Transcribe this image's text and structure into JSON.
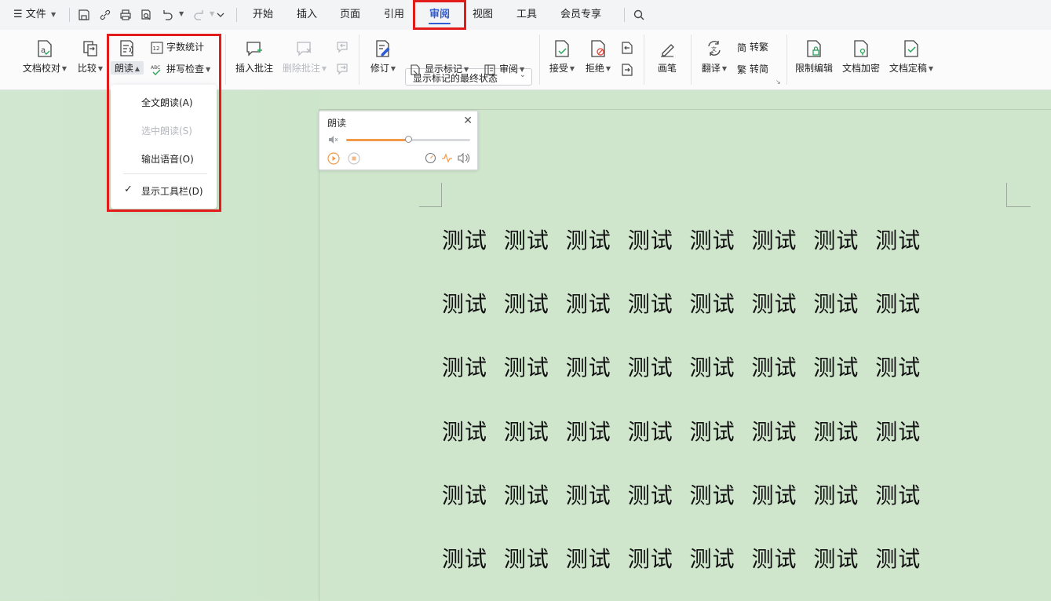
{
  "titlebar": {
    "file_menu": "文件",
    "tabs": [
      "开始",
      "插入",
      "页面",
      "引用",
      "审阅",
      "视图",
      "工具",
      "会员专享"
    ],
    "active_tab": "审阅"
  },
  "ribbon": {
    "proofread": "文档校对",
    "compare": "比较",
    "read_aloud": "朗读",
    "word_count": "字数统计",
    "spell_check": "拼写检查",
    "insert_comment": "插入批注",
    "delete_comment": "删除批注",
    "revise": "修订",
    "markup_state": "显示标记的最终状态",
    "show_markup": "显示标记",
    "review": "审阅",
    "accept": "接受",
    "reject": "拒绝",
    "pen": "画笔",
    "translate": "翻译",
    "to_traditional": "转繁",
    "to_simplified": "转简",
    "restrict_edit": "限制编辑",
    "encrypt": "文档加密",
    "finalize": "文档定稿",
    "trad_icon_text": "简",
    "simp_icon_text": "繁",
    "count_icon_text": "12",
    "abc_icon_text": "ABC"
  },
  "read_menu": {
    "items": [
      "全文朗读(A)",
      "选中朗读(S)",
      "输出语音(O)",
      "显示工具栏(D)"
    ],
    "check_mark": "✓"
  },
  "reader_panel": {
    "title": "朗读",
    "close": "✕",
    "volume_fraction": 0.5
  },
  "document": {
    "lines": [
      "测试 测试 测试 测试 测试 测试 测试 测试",
      "测试 测试 测试 测试 测试 测试 测试 测试",
      "测试 测试 测试 测试 测试 测试 测试 测试",
      "测试 测试 测试 测试 测试 测试 测试 测试",
      "测试 测试 测试 测试 测试 测试 测试 测试",
      "测试 测试 测试 测试 测试 测试 测试 测试"
    ]
  },
  "colors": {
    "accent": "#2f5bd3",
    "highlight_border": "#e21b1b",
    "doc_background": "#cfe6cd",
    "slider_fill": "#f29a4a"
  }
}
